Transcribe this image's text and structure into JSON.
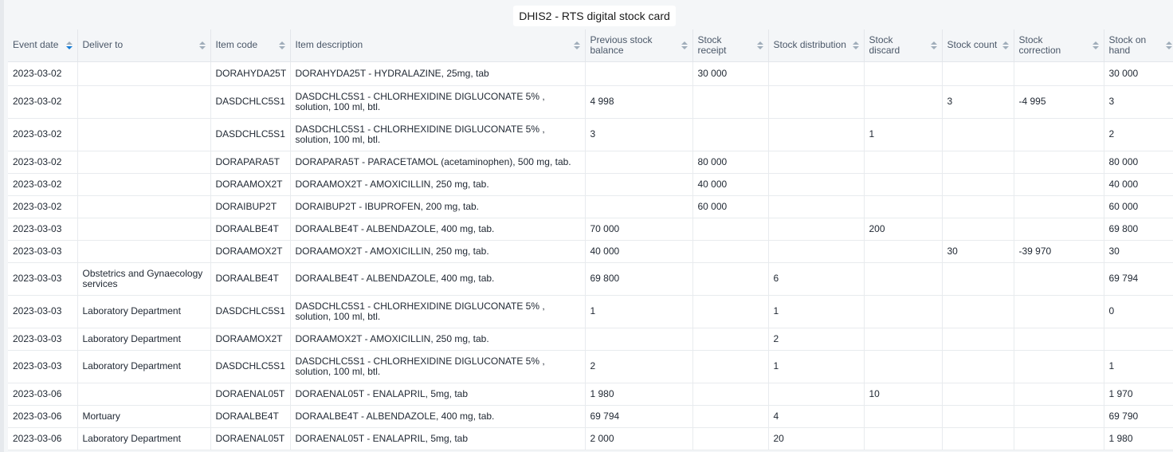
{
  "title": "DHIS2 - RTS digital stock card",
  "columns": [
    {
      "label": "Event date",
      "sort": "desc"
    },
    {
      "label": "Deliver to",
      "sort": "none"
    },
    {
      "label": "Item code",
      "sort": "none"
    },
    {
      "label": "Item description",
      "sort": "none"
    },
    {
      "label": "Previous stock balance",
      "sort": "none"
    },
    {
      "label": "Stock receipt",
      "sort": "none"
    },
    {
      "label": "Stock distribution",
      "sort": "none"
    },
    {
      "label": "Stock discard",
      "sort": "none"
    },
    {
      "label": "Stock count",
      "sort": "none"
    },
    {
      "label": "Stock correction",
      "sort": "none"
    },
    {
      "label": "Stock on hand",
      "sort": "none"
    }
  ],
  "rows": [
    [
      "2023-03-02",
      "",
      "DORAHYDA25T",
      "DORAHYDA25T - HYDRALAZINE, 25mg, tab",
      "",
      "30 000",
      "",
      "",
      "",
      "",
      "30 000"
    ],
    [
      "2023-03-02",
      "",
      "DASDCHLC5S1",
      "DASDCHLC5S1 - CHLORHEXIDINE DIGLUCONATE 5% , solution, 100 ml, btl.",
      "4 998",
      "",
      "",
      "",
      "3",
      "-4 995",
      "3"
    ],
    [
      "2023-03-02",
      "",
      "DASDCHLC5S1",
      "DASDCHLC5S1 - CHLORHEXIDINE DIGLUCONATE 5% , solution, 100 ml, btl.",
      "3",
      "",
      "",
      "1",
      "",
      "",
      "2"
    ],
    [
      "2023-03-02",
      "",
      "DORAPARA5T",
      "DORAPARA5T - PARACETAMOL (acetaminophen), 500 mg, tab.",
      "",
      "80 000",
      "",
      "",
      "",
      "",
      "80 000"
    ],
    [
      "2023-03-02",
      "",
      "DORAAMOX2T",
      "DORAAMOX2T - AMOXICILLIN, 250 mg, tab.",
      "",
      "40 000",
      "",
      "",
      "",
      "",
      "40 000"
    ],
    [
      "2023-03-02",
      "",
      "DORAIBUP2T",
      "DORAIBUP2T - IBUPROFEN, 200 mg, tab.",
      "",
      "60 000",
      "",
      "",
      "",
      "",
      "60 000"
    ],
    [
      "2023-03-03",
      "",
      "DORAALBE4T",
      "DORAALBE4T - ALBENDAZOLE, 400 mg, tab.",
      "70 000",
      "",
      "",
      "200",
      "",
      "",
      "69 800"
    ],
    [
      "2023-03-03",
      "",
      "DORAAMOX2T",
      "DORAAMOX2T - AMOXICILLIN, 250 mg, tab.",
      "40 000",
      "",
      "",
      "",
      "30",
      "-39 970",
      "30"
    ],
    [
      "2023-03-03",
      "Obstetrics and Gynaecology services",
      "DORAALBE4T",
      "DORAALBE4T - ALBENDAZOLE, 400 mg, tab.",
      "69 800",
      "",
      "6",
      "",
      "",
      "",
      "69 794"
    ],
    [
      "2023-03-03",
      "Laboratory Department",
      "DASDCHLC5S1",
      "DASDCHLC5S1 - CHLORHEXIDINE DIGLUCONATE 5% , solution, 100 ml, btl.",
      "1",
      "",
      "1",
      "",
      "",
      "",
      "0"
    ],
    [
      "2023-03-03",
      "Laboratory Department",
      "DORAAMOX2T",
      "DORAAMOX2T - AMOXICILLIN, 250 mg, tab.",
      "",
      "",
      "2",
      "",
      "",
      "",
      ""
    ],
    [
      "2023-03-03",
      "Laboratory Department",
      "DASDCHLC5S1",
      "DASDCHLC5S1 - CHLORHEXIDINE DIGLUCONATE 5% , solution, 100 ml, btl.",
      "2",
      "",
      "1",
      "",
      "",
      "",
      "1"
    ],
    [
      "2023-03-06",
      "",
      "DORAENAL05T",
      "DORAENAL05T - ENALAPRIL, 5mg, tab",
      "1 980",
      "",
      "",
      "10",
      "",
      "",
      "1 970"
    ],
    [
      "2023-03-06",
      "Mortuary",
      "DORAALBE4T",
      "DORAALBE4T - ALBENDAZOLE, 400 mg, tab.",
      "69 794",
      "",
      "4",
      "",
      "",
      "",
      "69 790"
    ],
    [
      "2023-03-06",
      "Laboratory Department",
      "DORAENAL05T",
      "DORAENAL05T - ENALAPRIL, 5mg, tab",
      "2 000",
      "",
      "20",
      "",
      "",
      "",
      "1 980"
    ]
  ]
}
